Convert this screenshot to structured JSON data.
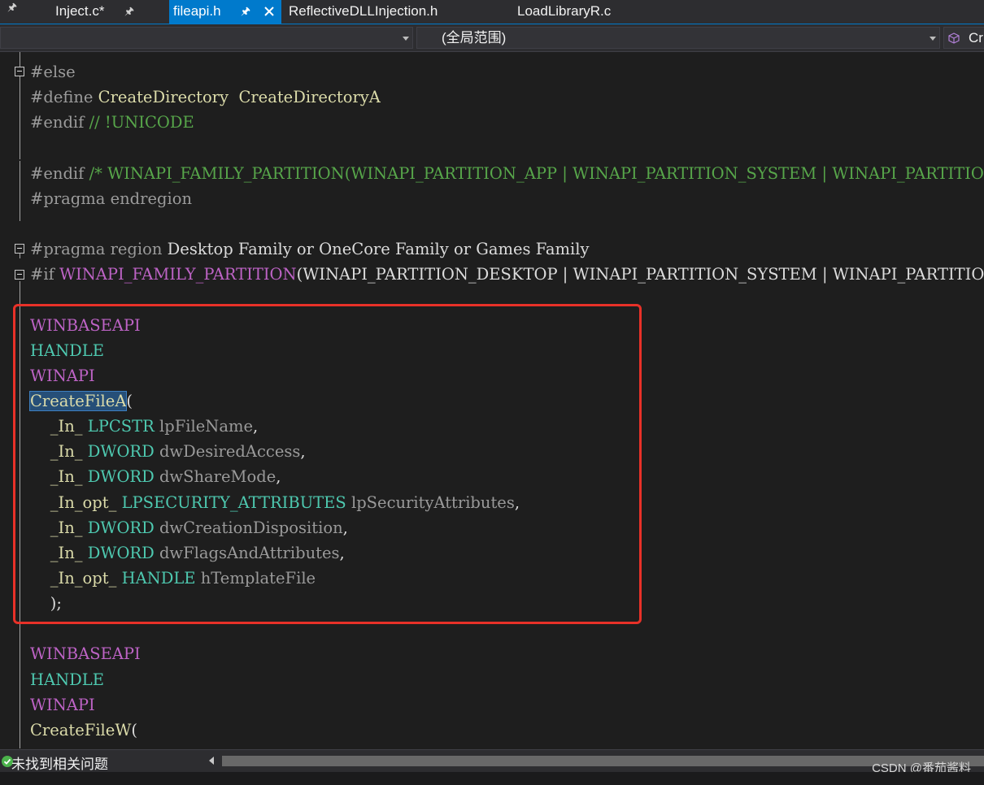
{
  "tabs": [
    {
      "label": "Inject.c*",
      "active": false
    },
    {
      "label": "fileapi.h",
      "active": true
    },
    {
      "label": "ReflectiveDLLInjection.h",
      "active": false
    },
    {
      "label": "LoadLibraryR.c",
      "active": false
    }
  ],
  "nav": {
    "scope_combo_value": "(全局范围)",
    "member_combo_value": "Cr"
  },
  "code_lines": [
    [
      [
        "#else",
        "c-pre"
      ]
    ],
    [
      [
        "#define ",
        "c-pre"
      ],
      [
        "CreateDirectory",
        "c-func"
      ],
      [
        "  ",
        "c-plain"
      ],
      [
        "CreateDirectoryA",
        "c-func"
      ]
    ],
    [
      [
        "#endif ",
        "c-pre"
      ],
      [
        "// !UNICODE",
        "c-comment"
      ]
    ],
    [],
    [
      [
        "#endif ",
        "c-pre"
      ],
      [
        "/* WINAPI_FAMILY_PARTITION(WINAPI_PARTITION_APP | WINAPI_PARTITION_SYSTEM | WINAPI_PARTITION_GAMES) */",
        "c-comment"
      ]
    ],
    [
      [
        "#pragma endregion",
        "c-pre"
      ]
    ],
    [],
    [
      [
        "#pragma region ",
        "c-pre"
      ],
      [
        "Desktop Family or OneCore Family or Games Family",
        "c-plain"
      ]
    ],
    [
      [
        "#if ",
        "c-pre"
      ],
      [
        "WINAPI_FAMILY_PARTITION",
        "c-macro"
      ],
      [
        "(WINAPI_PARTITION_DESKTOP | WINAPI_PARTITION_SYSTEM | WINAPI_PARTITION_GAMES)",
        "c-plain"
      ]
    ],
    [],
    [
      [
        "WINBASEAPI",
        "c-macro"
      ]
    ],
    [
      [
        "HANDLE",
        "c-type"
      ]
    ],
    [
      [
        "WINAPI",
        "c-macro"
      ]
    ],
    [
      [
        "CreateFileA",
        "c-func c-sel"
      ],
      [
        "(",
        "c-plain"
      ]
    ],
    [
      [
        "    ",
        "c-plain"
      ],
      [
        "_In_ ",
        "c-func"
      ],
      [
        "LPCSTR ",
        "c-type"
      ],
      [
        "lpFileName",
        "c-param"
      ],
      [
        ",",
        "c-plain"
      ]
    ],
    [
      [
        "    ",
        "c-plain"
      ],
      [
        "_In_ ",
        "c-func"
      ],
      [
        "DWORD ",
        "c-type"
      ],
      [
        "dwDesiredAccess",
        "c-param"
      ],
      [
        ",",
        "c-plain"
      ]
    ],
    [
      [
        "    ",
        "c-plain"
      ],
      [
        "_In_ ",
        "c-func"
      ],
      [
        "DWORD ",
        "c-type"
      ],
      [
        "dwShareMode",
        "c-param"
      ],
      [
        ",",
        "c-plain"
      ]
    ],
    [
      [
        "    ",
        "c-plain"
      ],
      [
        "_In_opt_ ",
        "c-func"
      ],
      [
        "LPSECURITY_ATTRIBUTES ",
        "c-type"
      ],
      [
        "lpSecurityAttributes",
        "c-param"
      ],
      [
        ",",
        "c-plain"
      ]
    ],
    [
      [
        "    ",
        "c-plain"
      ],
      [
        "_In_ ",
        "c-func"
      ],
      [
        "DWORD ",
        "c-type"
      ],
      [
        "dwCreationDisposition",
        "c-param"
      ],
      [
        ",",
        "c-plain"
      ]
    ],
    [
      [
        "    ",
        "c-plain"
      ],
      [
        "_In_ ",
        "c-func"
      ],
      [
        "DWORD ",
        "c-type"
      ],
      [
        "dwFlagsAndAttributes",
        "c-param"
      ],
      [
        ",",
        "c-plain"
      ]
    ],
    [
      [
        "    ",
        "c-plain"
      ],
      [
        "_In_opt_ ",
        "c-func"
      ],
      [
        "HANDLE ",
        "c-type"
      ],
      [
        "hTemplateFile",
        "c-param"
      ]
    ],
    [
      [
        "    );",
        "c-plain"
      ]
    ],
    [],
    [
      [
        "WINBASEAPI",
        "c-macro"
      ]
    ],
    [
      [
        "HANDLE",
        "c-type"
      ]
    ],
    [
      [
        "WINAPI",
        "c-macro"
      ]
    ],
    [
      [
        "CreateFileW",
        "c-func"
      ],
      [
        "(",
        "c-plain"
      ]
    ]
  ],
  "status": {
    "message": "未找到相关问题"
  },
  "watermark": "CSDN @番茄酱料",
  "colors": {
    "accent": "#007acc",
    "annotation_box": "#e83128",
    "status_ok": "#4bb24b"
  }
}
